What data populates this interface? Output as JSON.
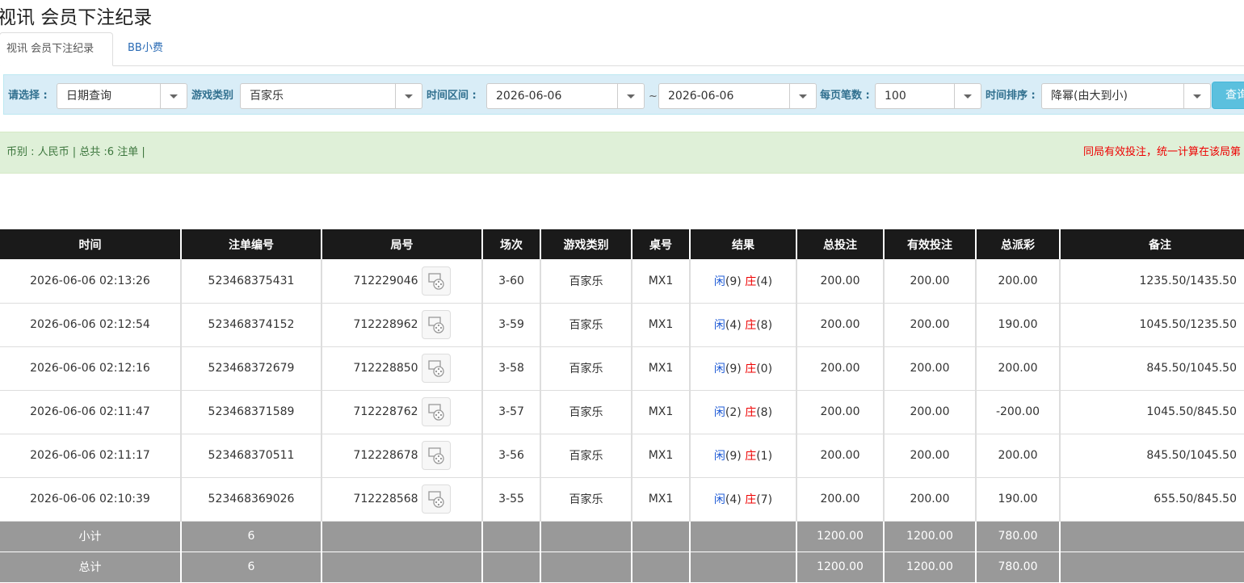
{
  "page": {
    "title": "视讯 会员下注纪录"
  },
  "tabs": [
    {
      "label": "视讯 会员下注纪录"
    },
    {
      "label": "BB小费"
    }
  ],
  "filters": {
    "select_label": "请选择 :",
    "select_value": "日期查询",
    "game_type_label": "游戏类别",
    "game_type_value": "百家乐",
    "time_range_label": "时间区间 :",
    "start_date": "2026-06-06",
    "range_sep": "~",
    "end_date": "2026-06-06",
    "page_size_label": "每页笔数 :",
    "page_size_value": "100",
    "sort_label": "时间排序 :",
    "sort_value": "降幂(由大到小)",
    "query_button": "查询"
  },
  "info": {
    "summary": "币别 : 人民币 | 总共 :6 注单 |",
    "notice": "同局有效投注，统一计算在该局第"
  },
  "table": {
    "headers": [
      "时间",
      "注单编号",
      "局号",
      "场次",
      "游戏类别",
      "桌号",
      "结果",
      "总投注",
      "有效投注",
      "总派彩",
      "备注"
    ],
    "rows": [
      {
        "time": "2026-06-06 02:13:26",
        "order_no": "523468375431",
        "round_no": "712229046",
        "session": "3-60",
        "game": "百家乐",
        "table": "MX1",
        "player_label": "闲",
        "player_score": "(9)",
        "banker_label": "庄",
        "banker_score": "(4)",
        "total_bet": "200.00",
        "valid_bet": "200.00",
        "payout": "200.00",
        "payout_negative": false,
        "remark": "1235.50/1435.50"
      },
      {
        "time": "2026-06-06 02:12:54",
        "order_no": "523468374152",
        "round_no": "712228962",
        "session": "3-59",
        "game": "百家乐",
        "table": "MX1",
        "player_label": "闲",
        "player_score": "(4)",
        "banker_label": "庄",
        "banker_score": "(8)",
        "total_bet": "200.00",
        "valid_bet": "200.00",
        "payout": "190.00",
        "payout_negative": false,
        "remark": "1045.50/1235.50"
      },
      {
        "time": "2026-06-06 02:12:16",
        "order_no": "523468372679",
        "round_no": "712228850",
        "session": "3-58",
        "game": "百家乐",
        "table": "MX1",
        "player_label": "闲",
        "player_score": "(9)",
        "banker_label": "庄",
        "banker_score": "(0)",
        "total_bet": "200.00",
        "valid_bet": "200.00",
        "payout": "200.00",
        "payout_negative": false,
        "remark": "845.50/1045.50"
      },
      {
        "time": "2026-06-06 02:11:47",
        "order_no": "523468371589",
        "round_no": "712228762",
        "session": "3-57",
        "game": "百家乐",
        "table": "MX1",
        "player_label": "闲",
        "player_score": "(2)",
        "banker_label": "庄",
        "banker_score": "(8)",
        "total_bet": "200.00",
        "valid_bet": "200.00",
        "payout": "-200.00",
        "payout_negative": true,
        "remark": "1045.50/845.50"
      },
      {
        "time": "2026-06-06 02:11:17",
        "order_no": "523468370511",
        "round_no": "712228678",
        "session": "3-56",
        "game": "百家乐",
        "table": "MX1",
        "player_label": "闲",
        "player_score": "(9)",
        "banker_label": "庄",
        "banker_score": "(1)",
        "total_bet": "200.00",
        "valid_bet": "200.00",
        "payout": "200.00",
        "payout_negative": false,
        "remark": "845.50/1045.50"
      },
      {
        "time": "2026-06-06 02:10:39",
        "order_no": "523468369026",
        "round_no": "712228568",
        "session": "3-55",
        "game": "百家乐",
        "table": "MX1",
        "player_label": "闲",
        "player_score": "(4)",
        "banker_label": "庄",
        "banker_score": "(7)",
        "total_bet": "200.00",
        "valid_bet": "200.00",
        "payout": "190.00",
        "payout_negative": false,
        "remark": "655.50/845.50"
      }
    ],
    "subtotal": {
      "label": "小计",
      "count": "6",
      "total_bet": "1200.00",
      "valid_bet": "1200.00",
      "payout": "780.00"
    },
    "grand_total": {
      "label": "总计",
      "count": "6",
      "total_bet": "1200.00",
      "valid_bet": "1200.00",
      "payout": "780.00"
    }
  },
  "colors": {
    "header_bg": "#1a1a1a",
    "link_blue": "#1f5bd6",
    "negative_red": "#e00",
    "info_bg": "#dff0d8",
    "filter_bg": "#d9edf7",
    "total_bg": "#999999"
  },
  "icons": {
    "replay": "video-replay-icon",
    "dropdown": "chevron-down-icon"
  }
}
